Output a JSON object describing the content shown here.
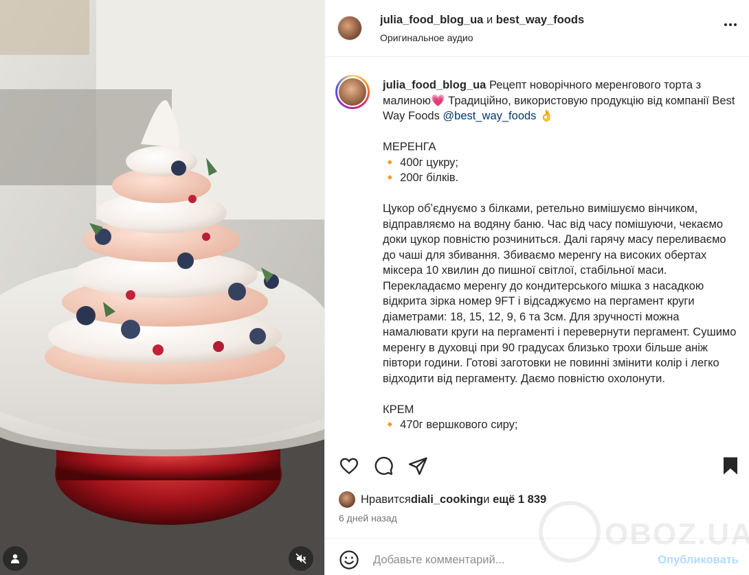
{
  "header": {
    "user1": "julia_food_blog_ua",
    "conjunction": "и",
    "user2": "best_way_foods",
    "audio": "Оригинальное аудио",
    "more_icon": "more-horizontal-icon"
  },
  "caption": {
    "username": "julia_food_blog_ua",
    "intro_text": " Рецепт новорічного меренгового торта з малиною",
    "heart": "💗",
    "intro_text2": " Традиційно, використовую продукцію від компанії Best Way Foods ",
    "mention": "@best_way_foods",
    "emoji_ok": " 👌",
    "section1_title": "МЕРЕНГА",
    "section1_items": [
      "400г цукру;",
      "200г білків."
    ],
    "bullet": "🔸",
    "paragraph1": "Цукор обʼєднуємо з білками, ретельно вимішуємо вінчиком, відправляємо на водяну баню. Час від часу помішуючи, чекаємо доки цукор повністю розчиниться. Далі гарячу масу переливаємо до чаші для збивання. Збиваємо меренгу на високих обертах міксера 10 хвилин до пишної світлої, стабільної маси. Перекладаємо меренгу до кондитерського мішка з насадкою відкрита зірка номер 9FT і відсаджуємо на пергамент круги діаметрами: 18, 15, 12, 9, 6 та 3см. Для зручності можна намалювати круги на пергаменті і перевернути пергамент. Сушимо меренгу в духовці при 90 градусах близько трохи більше аніж півтори години. Готові заготовки не повинні змінити колір і легко відходити від пергаменту. Даємо повністю охолонути.",
    "section2_title": "КРЕМ",
    "section2_items": [
      "470г вершкового сиру;"
    ]
  },
  "actions": {
    "like_icon": "heart-icon",
    "comment_icon": "comment-icon",
    "share_icon": "send-icon",
    "save_icon": "bookmark-icon"
  },
  "likes": {
    "prefix": "Нравится ",
    "user": "diali_cooking",
    "middle": " и ",
    "count": "ещё 1 839"
  },
  "date": "6 дней назад",
  "comment": {
    "placeholder": "Добавьте комментарий...",
    "publish": "Опубликовать",
    "emoji_icon": "emoji-icon"
  },
  "watermark": "OBOZ.UA"
}
